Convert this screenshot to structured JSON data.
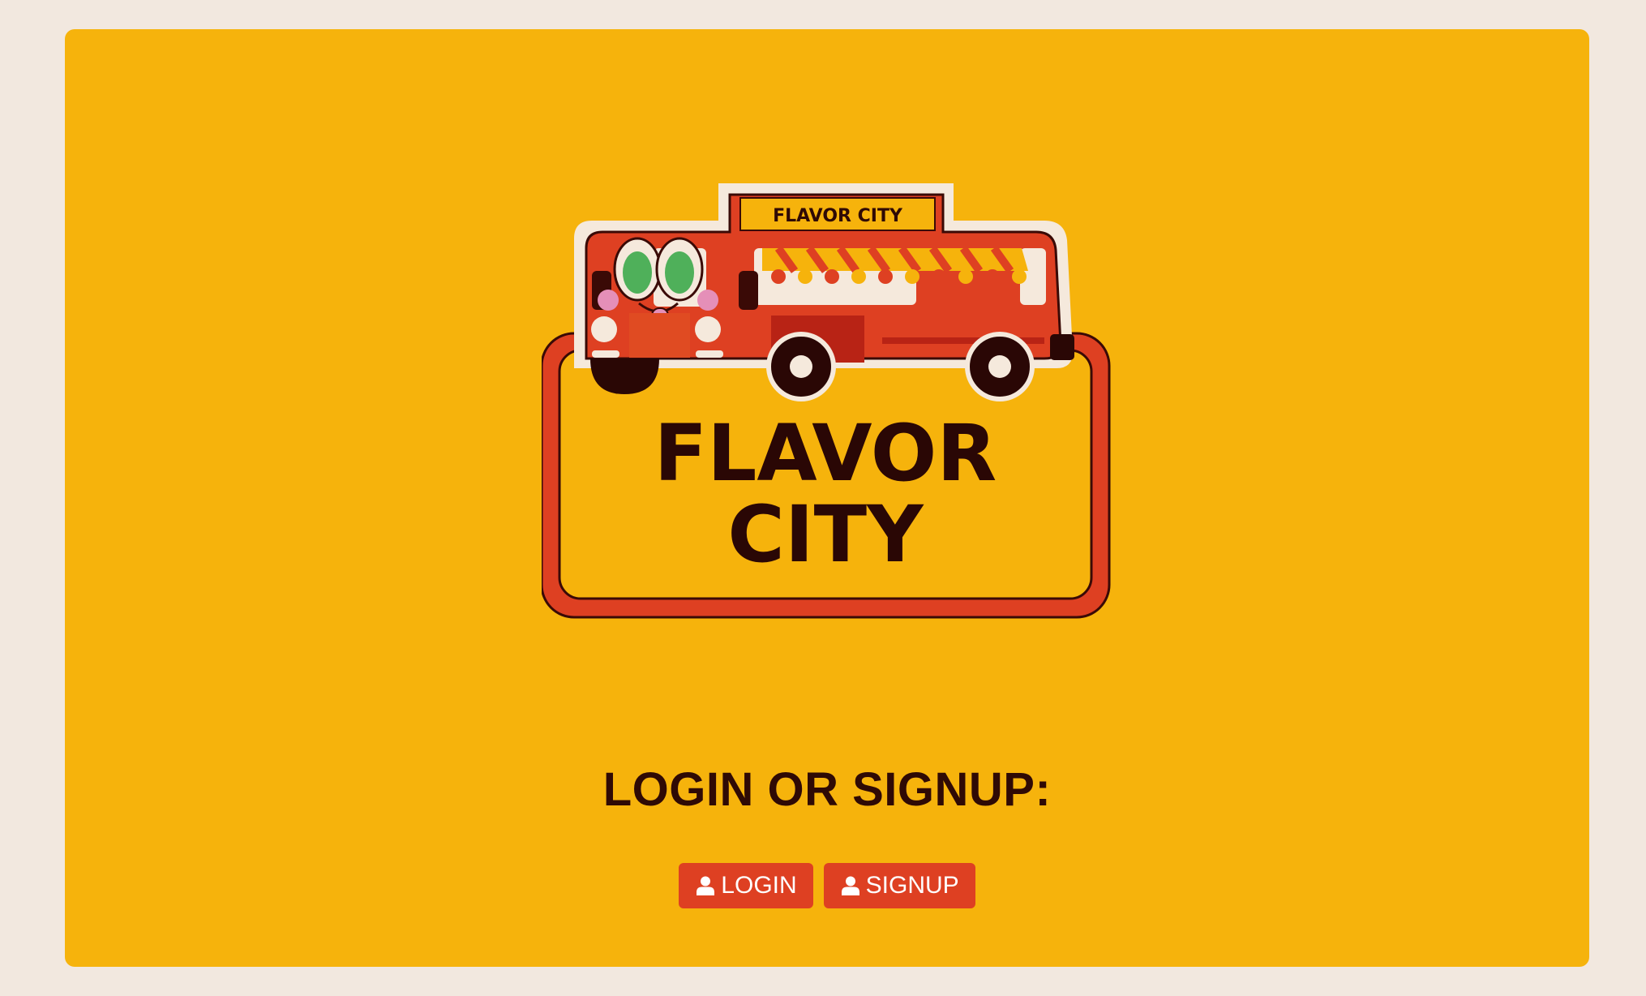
{
  "logo": {
    "sign_text": "FLAVOR CITY",
    "title_line1": "FLAVOR",
    "title_line2": "CITY"
  },
  "auth": {
    "heading": "LOGIN OR SIGNUP:",
    "login_label": "LOGIN",
    "signup_label": "SIGNUP",
    "button_icon": "user-icon"
  },
  "colors": {
    "page_background": "#f2e8df",
    "card_background": "#f6b30c",
    "accent": "#de4022",
    "heading_text": "#2f0a05",
    "button_text": "#ffffff"
  }
}
